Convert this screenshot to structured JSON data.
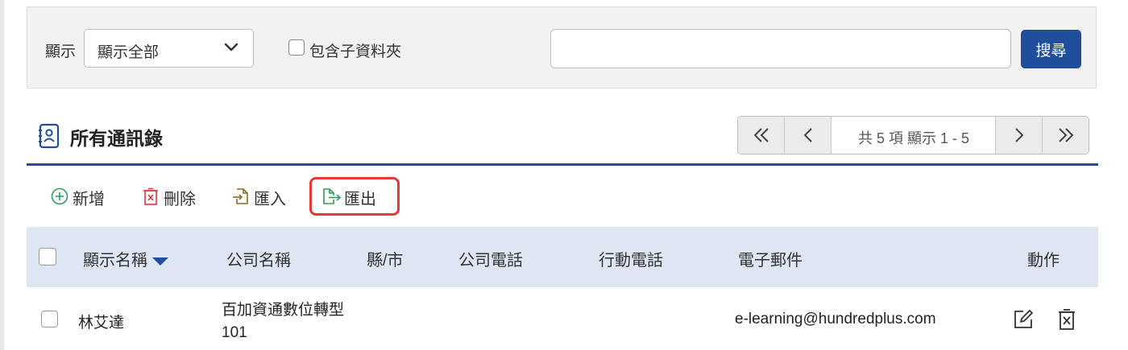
{
  "filter": {
    "show_label": "顯示",
    "show_select_value": "顯示全部",
    "include_subfolders_label": "包含子資料夾",
    "search_input_value": "",
    "search_button_label": "搜尋"
  },
  "header": {
    "title": "所有通訊錄"
  },
  "pager": {
    "info": "共 5 項 顯示 1 - 5"
  },
  "toolbar": {
    "add_label": "新增",
    "delete_label": "刪除",
    "import_label": "匯入",
    "export_label": "匯出"
  },
  "table": {
    "columns": [
      "顯示名稱",
      "公司名稱",
      "縣/市",
      "公司電話",
      "行動電話",
      "電子郵件",
      "動作"
    ],
    "rows": [
      {
        "name": "林艾達",
        "company": "百加資通數位轉型101",
        "city": "",
        "company_phone": "",
        "mobile_phone": "",
        "email": "e-learning@hundredplus.com"
      }
    ]
  },
  "colors": {
    "primary": "#1f4e9c",
    "add_icon": "#2e9e5b",
    "delete_icon": "#d9363e",
    "import_icon": "#8a6d1e",
    "export_icon": "#2e9e5b",
    "highlight": "#e53935",
    "header_bg": "#dfe6f3"
  },
  "icons": {
    "add": "plus-circle-icon",
    "delete": "trash-x-icon",
    "import": "file-import-icon",
    "export": "file-export-icon",
    "contacts": "contact-book-icon",
    "row_edit": "edit-icon",
    "row_delete": "trash-x-icon"
  }
}
